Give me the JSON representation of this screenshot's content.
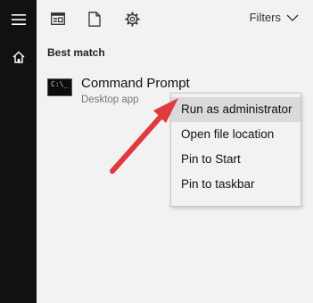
{
  "search_panel": {
    "filters_label": "Filters",
    "best_match_label": "Best match"
  },
  "result": {
    "title": "Command Prompt",
    "subtitle": "Desktop app",
    "icon_text": "C:\\_"
  },
  "context_menu": {
    "items": [
      {
        "label": "Run as administrator",
        "highlighted": true
      },
      {
        "label": "Open file location"
      },
      {
        "label": "Pin to Start"
      },
      {
        "label": "Pin to taskbar"
      }
    ]
  },
  "colors": {
    "rail": "#111111",
    "panel": "#f2f2f2",
    "highlight": "#dadada",
    "arrow": "#e0393e"
  }
}
